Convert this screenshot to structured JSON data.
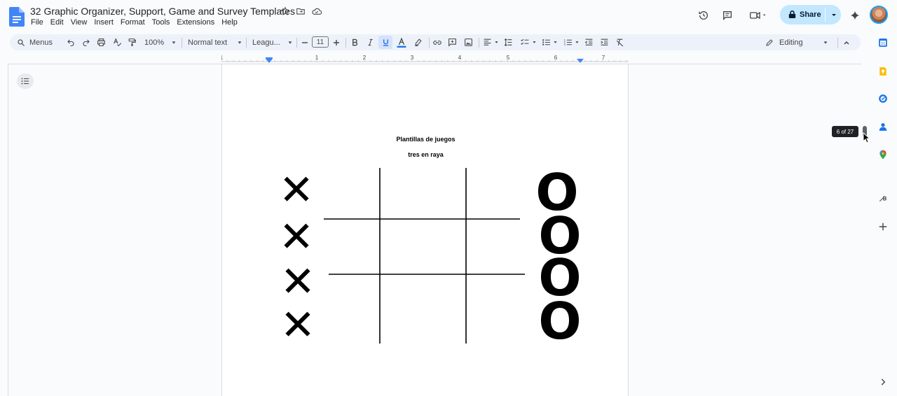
{
  "app": {
    "title": "32 Graphic Organizer, Support, Game and Survey Templates",
    "menu": [
      "File",
      "Edit",
      "View",
      "Insert",
      "Format",
      "Tools",
      "Extensions",
      "Help"
    ],
    "share_label": "Share"
  },
  "toolbar": {
    "search_label": "Menus",
    "zoom": "100%",
    "style": "Normal text",
    "font": "Leagu...",
    "font_size": "11",
    "mode": "Editing"
  },
  "ruler": {
    "ticks": [
      "1",
      "1",
      "2",
      "3",
      "4",
      "5",
      "6",
      "7"
    ]
  },
  "document": {
    "heading": "Plantillas de juegos",
    "subheading": "tres en raya",
    "x_marks": [
      "✕",
      "✕",
      "✕",
      "✕"
    ],
    "o_marks": [
      "O",
      "O",
      "O",
      "O"
    ]
  },
  "scroll": {
    "page_indicator": "6 of 27"
  },
  "colors": {
    "accent": "#1a73e8",
    "share_bg": "#c2e7ff",
    "toolbar_bg": "#edf2fa",
    "underline_active": "#d3e3fd"
  },
  "icons": {
    "sidepanel": [
      "calendar-icon",
      "keep-icon",
      "tasks-icon",
      "contacts-icon",
      "maps-icon",
      "addon-icon",
      "add-icon"
    ]
  }
}
